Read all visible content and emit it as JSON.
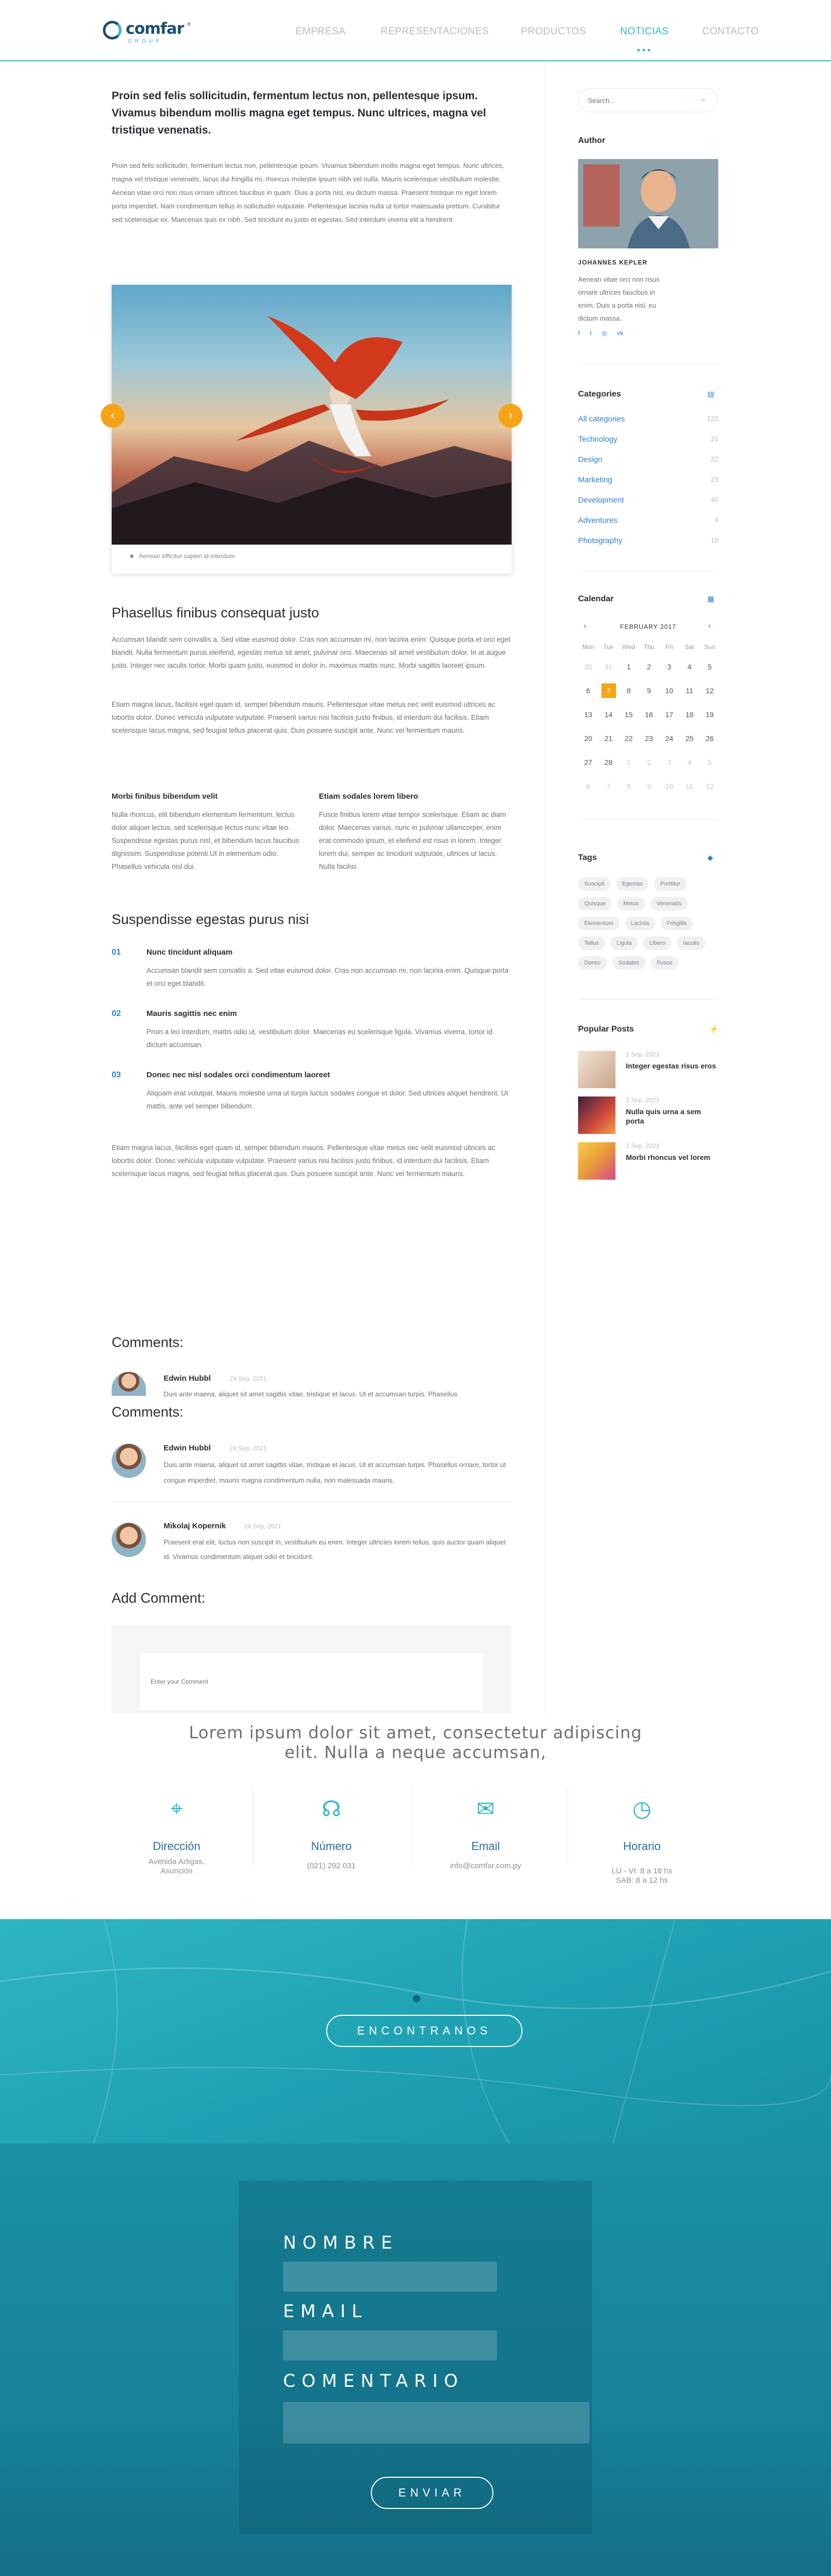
{
  "header": {
    "logo_word": "comfar",
    "logo_reg": "®",
    "logo_sub": "GROUP",
    "nav": [
      "EMPRESA",
      "REPRESENTACIONES",
      "PRODUCTOS",
      "NOTICIAS",
      "CONTACTO"
    ],
    "active": "NOTICIAS"
  },
  "article": {
    "lead": "Proin sed felis sollicitudin, fermentum lectus non, pellentesque ipsum. Vivamus bibendum mollis magna eget tempus. Nunc ultrices, magna vel tristique venenatis.",
    "intro": "Proin sed felis sollicitudin, fermentum lectus non, pellentesque ipsum. Vivamus bibendum mollis magna eget tempus. Nunc ultrices, magna vel tristique venenatis, lacus dui fringilla mi, rhoncus molestie ipsum nibh vel nulla. Mauris scelerisque vestibulum molestie. Aenean vitae orci non risus ornare ultrices faucibus in quam. Duis a porta nisl, eu dictum massa. Praesent tristique mi eget lorem porta imperdiet. Nam condimentum tellus in sollicitudin vulputate. Pellentesque lacinia nulla ut tortor malesuada pretium. Curabitur sed scelerisque ex. Maecenas quis ex nibh. Sed tincidunt eu justo et egestas. Sed interdum viverra elit a hendrerit.",
    "caption": "Aenean efficitur sapien id interdum",
    "h2a": "Phasellus finibus consequat justo",
    "p1": "Accumsan blandit sem convallis a. Sed vitae euismod dolor. Cras non accumsan mi, non lacinia enim. Quisque porta et orci eget blandit. Nulla fermentum purus eleifend, egestas metus sit amet, pulvinar orci. Maecenas sit amet vestibulum dolor. In at augue justo. Integer nec iaculis tortor. Morbi quam justo, euismod in dolor in, maximus mattis nunc. Morbi sagittis laoreet ipsum.",
    "p2": "Etiam magna lacus, facilisis eget quam id, semper bibendum mauris. Pellentesque vitae metus nec velit euismod ultrices ac lobortis dolor. Donec vehicula vulputate vulputate. Praesent varius nisi facilisis justo finibus, id interdum dui facilisis. Etiam scelerisque lacus magna, sed feugiat tellus placerat quis. Duis posuere suscipit ante. Nunc vel fermentum mauris.",
    "col1_h": "Morbi finibus bibendum velit",
    "col1_p": "Nulla rhoncus, elit bibendum elementum fermentum, lectus dolor aliquet lectus, sed scelerisque lectus nunc vitae leo. Suspendisse egestas purus nisl, et bibendum lacus faucibus dignissim. Suspendisse potenti.Ut in elementum odio. Phasellus vehicula nisl dui.",
    "col2_h": "Etiam sodales lorem libero",
    "col2_p": "Fusce finibus lorem vitae tempor scelerisque. Etiam ac diam dolor. Maecenas varius, nunc in pulvinar ullamcorper, enim erat commodo ipsum, et eleifend est risus in lorem. Integer lorem dui, semper ac tincidunt vulputate, ultrices ut lacus. Nulla facilisi.",
    "h2b": "Suspendisse egestas purus nisi",
    "list": [
      {
        "n": "01",
        "h": "Nunc tincidunt aliquam",
        "p": "Accumsan blandit sem convallis a. Sed vitae euismod dolor. Cras non accumsan mi, non lacinia enim. Quisque porta et orci eget blandit."
      },
      {
        "n": "02",
        "h": "Mauris sagittis nec enim",
        "p": "Proin a leo interdum, mattis odio ut, vestibulum dolor. Maecenas eu scelerisque ligula. Vivamus viverra, tortor id dictum accumsan."
      },
      {
        "n": "03",
        "h": "Donec nec nisl sodales orci condimentum laoreet",
        "p": "Aliquam erat volutpat. Mauris molestie urna ut turpis luctus sodales congue et dolor. Sed ultrices aliquet hendrerit. Ut mattis, ante vel semper bibendum."
      }
    ],
    "p3": "Etiam magna lacus, facilisis eget quam id, semper bibendum mauris. Pellentesque vitae metus nec velit euismod ultrices ac lobortis dolor. Donec vehicula vulputate vulputate. Praesent varius nisi facilisis justo finibus, id interdum dui facilisis. Etiam scelerisque lacus magna, sed feugiat tellus placerat quis. Duis posuere suscipit ante. Nunc vel fermentum mauris."
  },
  "comments": {
    "title1": "Comments:",
    "title2": "Comments:",
    "items": [
      {
        "name": "Edwin Hubbl",
        "date": "24 Sep, 2021",
        "text": "Duis ante maena, aliquet sit amet sagittis vitae, tristique et lacus. Ut et accumsan turpis. Phasellus"
      },
      {
        "name": "Edwin Hubbl",
        "date": "24 Sep, 2021",
        "text": "Duis ante maena, aliquet sit amet sagittis vitae, tristique et lacus. Ut et accumsan turpis. Phasellus ornare, tortor ut congue imperdiet, mauris magna condimentum nulla, non malesuada mauris."
      },
      {
        "name": "Mikolaj Kopernik",
        "date": "24 Sep, 2021",
        "text": "Praesent erat elit, luctus non suscipit in, vestibulum eu enim. Integer ultricies lorem tellus, quis auctor quam aliquet id. Vivamus condimentum aliquet odio et tincidunt."
      }
    ],
    "add_title": "Add Comment:",
    "placeholder": "Enter your Comment"
  },
  "sidebar": {
    "search_placeholder": "Search...",
    "author_h": "Author",
    "author_name": "JOHANNES KEPLER",
    "author_bio": "Aenean vitae orci non risus ornare ultrices faucibus in enim. Duis a porta nisl, eu dictum massa.",
    "categories_h": "Categories",
    "categories": [
      {
        "name": "All categories",
        "count": "122"
      },
      {
        "name": "Technology",
        "count": "21"
      },
      {
        "name": "Design",
        "count": "22"
      },
      {
        "name": "Marketing",
        "count": "23"
      },
      {
        "name": "Development",
        "count": "40"
      },
      {
        "name": "Adventures",
        "count": "9"
      },
      {
        "name": "Photography",
        "count": "10"
      }
    ],
    "calendar_h": "Calendar",
    "calendar_month": "FEBRUARY 2017",
    "weekdays": [
      "Mon",
      "Tue",
      "Wed",
      "Thu",
      "Fri",
      "Sat",
      "Sun"
    ],
    "weeks": [
      [
        "30",
        "31",
        "1",
        "2",
        "3",
        "4",
        "5"
      ],
      [
        "6",
        "7",
        "8",
        "9",
        "10",
        "11",
        "12"
      ],
      [
        "13",
        "14",
        "15",
        "16",
        "17",
        "18",
        "19"
      ],
      [
        "20",
        "21",
        "22",
        "23",
        "24",
        "25",
        "26"
      ],
      [
        "27",
        "28",
        "1",
        "2",
        "3",
        "4",
        "5"
      ],
      [
        "6",
        "7",
        "8",
        "9",
        "10",
        "11",
        "12"
      ]
    ],
    "tags_h": "Tags",
    "tags": [
      [
        "Suscipit",
        "Egestas",
        "Porttitor"
      ],
      [
        "Quisque",
        "Metus",
        "Venenatis"
      ],
      [
        "Elementum",
        "Lacinia",
        "Fringilla"
      ],
      [
        "Tellus",
        "Ligula",
        "Libero",
        "Iaculis"
      ],
      [
        "Donec",
        "Sodales",
        "Fusce"
      ]
    ],
    "popular_h": "Popular Posts",
    "popular": [
      {
        "date": "2 Sep, 2021",
        "title": "Integer egestas risus eros"
      },
      {
        "date": "2 Sep, 2021",
        "title": "Nulla quis urna a sem porta"
      },
      {
        "date": "2 Sep, 2021",
        "title": "Morbi rhoncus vel lorem"
      }
    ]
  },
  "contact": {
    "headline": "Lorem ipsum dolor sit amet, consectetur adipiscing elit. Nulla a neque accumsan,",
    "items": [
      {
        "icon": "location-pin-icon",
        "title": "Dirección",
        "line1": "Avenida Artigas,",
        "line2": "Asunción"
      },
      {
        "icon": "headset-icon",
        "title": "Número",
        "line1": "(021) 292 031",
        "line2": ""
      },
      {
        "icon": "chat-icon",
        "title": "Email",
        "line1": "info@comfar.com.py",
        "line2": ""
      },
      {
        "icon": "clock-icon",
        "title": "Horario",
        "line1": "LU - VI: 8 a 18 hs",
        "line2": "SAB: 8 a 12 hs"
      }
    ]
  },
  "map": {
    "button": "ENCONTRANOS"
  },
  "form": {
    "nombre": "NOMBRE",
    "email": "EMAIL",
    "comentario": "COMENTARIO",
    "submit": "ENVIAR"
  },
  "colors": {
    "teal": "#2fb8c6",
    "orange": "#f4a416",
    "blue": "#2b7fd0",
    "navy": "#1c4f70"
  }
}
